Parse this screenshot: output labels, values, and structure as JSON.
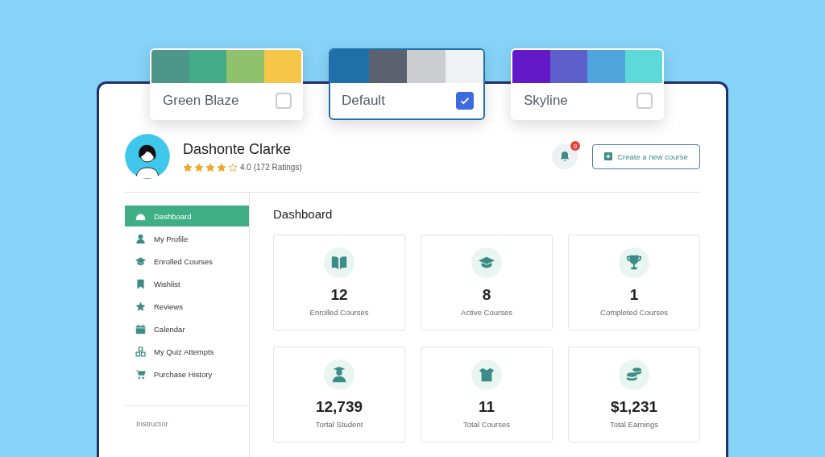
{
  "themes": [
    {
      "name": "Green Blaze",
      "selected": false,
      "swatches": [
        {
          "color": "#4f968a"
        },
        {
          "color": "#43ab88"
        },
        {
          "color": "#90c16c"
        },
        {
          "color": "#f6c648"
        }
      ]
    },
    {
      "name": "Default",
      "selected": true,
      "swatches": [
        {
          "color": "#1f6fa8"
        },
        {
          "color": "#5b616e"
        },
        {
          "color": "#cbcdd1"
        },
        {
          "color": "#eff1f5"
        }
      ]
    },
    {
      "name": "Skyline",
      "selected": false,
      "swatches": [
        {
          "color": "#6419c9"
        },
        {
          "color": "#5d60cc"
        },
        {
          "color": "#4fa4dc"
        },
        {
          "color": "#5dd9d8"
        }
      ]
    }
  ],
  "profile": {
    "name": "Dashonte Clarke",
    "stars": 4,
    "rating": "4.0 (172 Ratings)"
  },
  "notifications": {
    "count": "9"
  },
  "create_button": "Create a new course",
  "sidebar": {
    "items": [
      {
        "label": "Dashboard",
        "selected": true
      },
      {
        "label": "My Profile",
        "selected": false
      },
      {
        "label": "Enrolled Courses",
        "selected": false
      },
      {
        "label": "Wishlist",
        "selected": false
      },
      {
        "label": "Reviews",
        "selected": false
      },
      {
        "label": "Calendar",
        "selected": false
      },
      {
        "label": "My Quiz Attempts",
        "selected": false
      },
      {
        "label": "Purchase History",
        "selected": false
      }
    ],
    "section": "Instructor"
  },
  "title": "Dashboard",
  "stats": [
    {
      "value": "12",
      "label": "Enrolled Courses"
    },
    {
      "value": "8",
      "label": "Active Courses"
    },
    {
      "value": "1",
      "label": "Completed Courses"
    },
    {
      "value": "12,739",
      "label": "Tortal Student"
    },
    {
      "value": "11",
      "label": "Total Courses"
    },
    {
      "value": "$1,231",
      "label": "Total Earnings"
    }
  ]
}
